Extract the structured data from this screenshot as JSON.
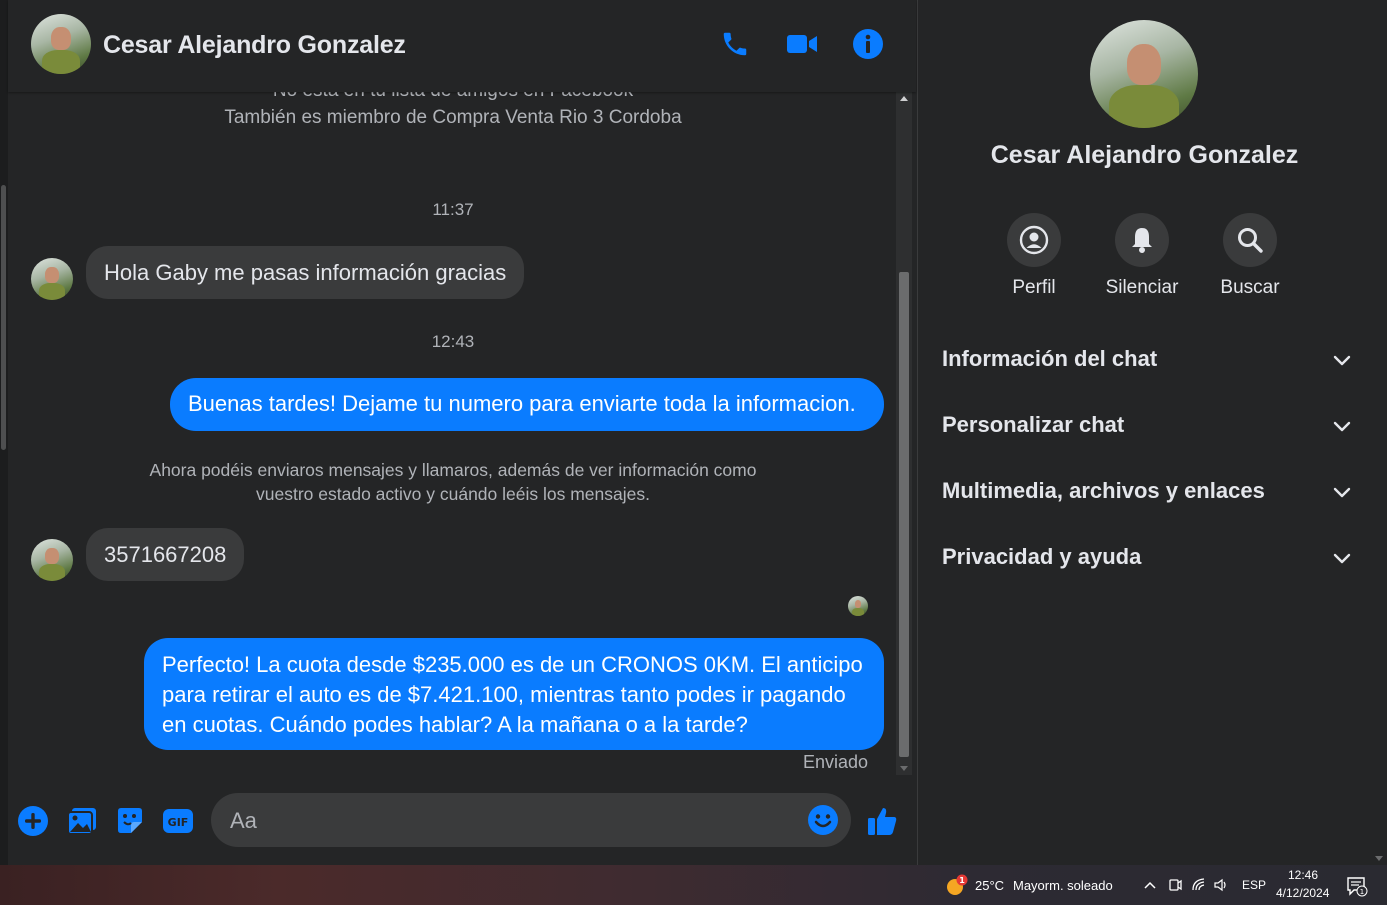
{
  "contact": {
    "name": "Cesar Alejandro Gonzalez"
  },
  "chat": {
    "context_cut": "No está en tu lista de amigos en Facebook",
    "context_group": "También es miembro de Compra Venta Rio 3 Cordoba",
    "time_1": "11:37",
    "msg_in_1": "Hola Gaby me pasas información gracias",
    "time_2": "12:43",
    "msg_out_1": "Buenas tardes! Dejame tu numero para enviarte toda la informacion.",
    "notice_line1": "Ahora podéis enviaros mensajes y llamaros, además de ver información como",
    "notice_line2": "vuestro estado activo y cuándo leéis los mensajes.",
    "msg_in_2": "3571667208",
    "msg_out_2_line1": "Perfecto! La cuota desde $235.000 es de un CRONOS 0KM. El anticipo",
    "msg_out_2_line2": "para retirar el auto es de $7.421.100, mientras tanto podes ir pagando",
    "msg_out_2_line3": "en cuotas. Cuándo podes hablar? A la mañana o a la tarde?",
    "status": "Enviado"
  },
  "composer": {
    "placeholder": "Aa",
    "icons": [
      "plus-circle-icon",
      "photo-icon",
      "sticker-icon",
      "gif-icon",
      "emoji-icon",
      "like-icon"
    ]
  },
  "header": {
    "icons": [
      "phone-icon",
      "video-icon",
      "info-icon"
    ]
  },
  "side": {
    "actions": [
      {
        "label": "Perfil",
        "icon": "profile-icon"
      },
      {
        "label": "Silenciar",
        "icon": "bell-icon"
      },
      {
        "label": "Buscar",
        "icon": "search-icon"
      }
    ],
    "sections": [
      "Información del chat",
      "Personalizar chat",
      "Multimedia, archivos y enlaces",
      "Privacidad y ayuda"
    ]
  },
  "taskbar": {
    "weather_badge": "1",
    "temperature": "25°C",
    "weather": "Mayorm. soleado",
    "language": "ESP",
    "time": "12:46",
    "date": "4/12/2024",
    "notification_count": "1"
  },
  "colors": {
    "accent": "#0a7cff",
    "background": "#242526",
    "bubble_in": "#3a3b3c"
  }
}
